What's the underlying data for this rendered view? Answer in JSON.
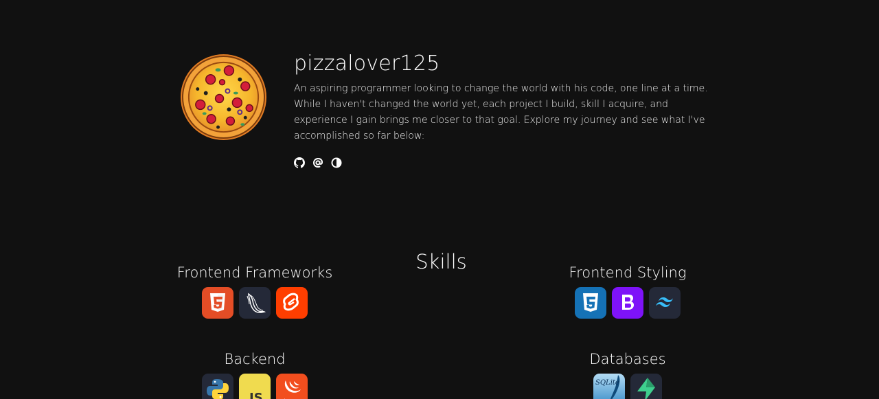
{
  "profile": {
    "username": "pizzalover125",
    "bio": "An aspiring programmer looking to change the world with his code, one line at a time. While I haven't changed the world yet, each project I build, skill I acquire, and experience I gain brings me closer to that goal. Explore my journey and see what I've accomplished so far below:",
    "avatar_icon": "pizza-icon",
    "socials": [
      {
        "icon": "github-icon"
      },
      {
        "icon": "at-icon"
      },
      {
        "icon": "contrast-icon"
      }
    ]
  },
  "skills": {
    "title": "Skills",
    "groups": [
      {
        "title": "Frontend Frameworks",
        "icons": [
          "html5-icon",
          "flask-icon",
          "svelte-icon"
        ]
      },
      {
        "title": "Frontend Styling",
        "icons": [
          "css3-icon",
          "bootstrap-icon",
          "tailwind-icon"
        ]
      },
      {
        "title": "Backend",
        "icons": [
          "python-icon",
          "javascript-icon",
          "jquery-icon"
        ]
      },
      {
        "title": "Databases",
        "icons": [
          "sqlite-icon",
          "supabase-icon"
        ]
      }
    ]
  },
  "colors": {
    "background": "#111111",
    "text": "#ffffff",
    "html5": "#e44d26",
    "svelte": "#ff3e00",
    "css3": "#1572b6",
    "bootstrap": "#7952b3",
    "tailwind": "#38bdf8",
    "javascript": "#f0db4f",
    "jquery": "#f24e1e",
    "supabase": "#3ecf8e",
    "dark_tile": "#242938"
  },
  "icon_text": {
    "js": "JS",
    "jquery": "jQuery",
    "sqlite": "SQLite"
  }
}
